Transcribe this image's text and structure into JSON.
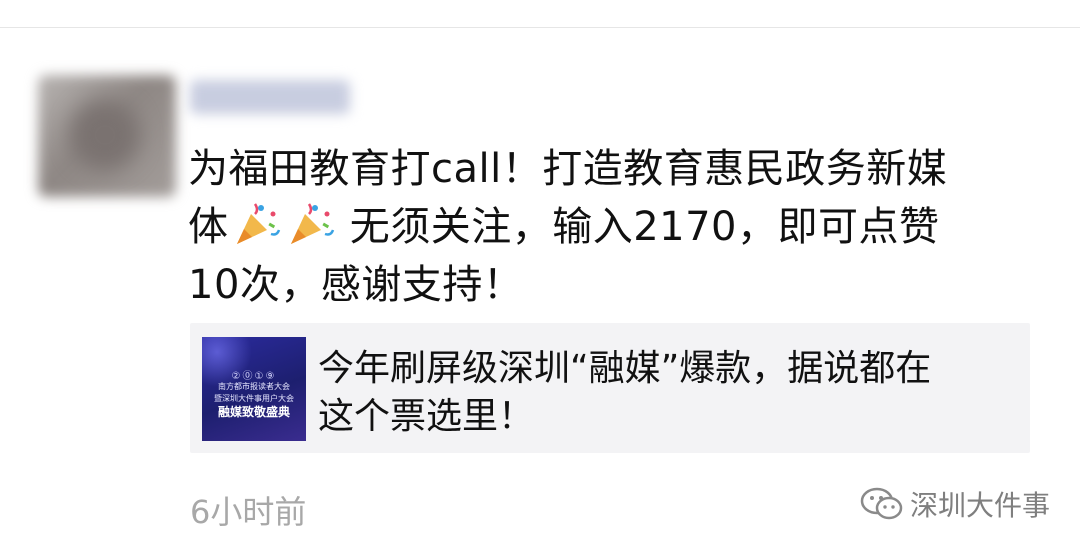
{
  "post": {
    "text_line1": "为福田教育打call！打造教育惠民政务新媒",
    "text_line2_start": "体",
    "text_line2_end": " 无须关注，输入2170，即可点赞",
    "text_line3": "10次，感谢支持！",
    "emoji_icon": "party-popper-icon"
  },
  "link_card": {
    "thumbnail": {
      "year": "②⓪①⑨",
      "line1": "南方都市报读者大会",
      "line2": "暨深圳大件事用户大会",
      "line3": "融媒致敬盛典"
    },
    "title_line1": "今年刷屏级深圳“融媒”爆款，据说都在",
    "title_line2": "这个票选里！"
  },
  "timestamp": "6小时前",
  "watermark": {
    "icon": "wechat-icon",
    "text": "深圳大件事"
  }
}
